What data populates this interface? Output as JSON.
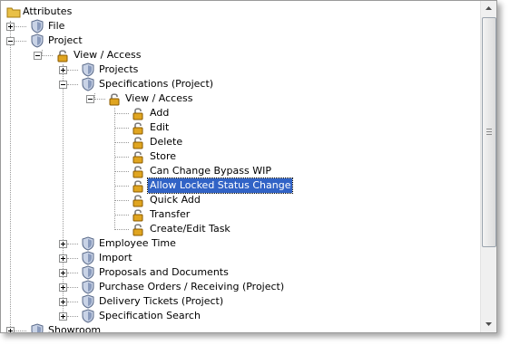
{
  "tree": {
    "nodes": [
      {
        "label": "Attributes",
        "icon": "folder-icon",
        "expander": "none"
      },
      {
        "label": "File",
        "icon": "shield-icon",
        "expander": "plus"
      },
      {
        "label": "Project",
        "icon": "shield-icon",
        "expander": "minus"
      },
      {
        "label": "View / Access",
        "icon": "padlock-icon",
        "expander": "minus"
      },
      {
        "label": "Projects",
        "icon": "shield-icon",
        "expander": "plus"
      },
      {
        "label": "Specifications (Project)",
        "icon": "shield-icon",
        "expander": "minus"
      },
      {
        "label": "View / Access",
        "icon": "padlock-icon",
        "expander": "minus"
      },
      {
        "label": "Add",
        "icon": "padlock-icon",
        "expander": "none"
      },
      {
        "label": "Edit",
        "icon": "padlock-icon",
        "expander": "none"
      },
      {
        "label": "Delete",
        "icon": "padlock-icon",
        "expander": "none"
      },
      {
        "label": "Store",
        "icon": "padlock-icon",
        "expander": "none"
      },
      {
        "label": "Can Change Bypass WIP",
        "icon": "padlock-icon",
        "expander": "none"
      },
      {
        "label": "Allow Locked Status Change",
        "icon": "padlock-icon",
        "expander": "none",
        "selected": true
      },
      {
        "label": "Quick Add",
        "icon": "padlock-icon",
        "expander": "none"
      },
      {
        "label": "Transfer",
        "icon": "padlock-icon",
        "expander": "none"
      },
      {
        "label": "Create/Edit Task",
        "icon": "padlock-icon",
        "expander": "none"
      },
      {
        "label": "Employee Time",
        "icon": "shield-icon",
        "expander": "plus"
      },
      {
        "label": "Import",
        "icon": "shield-icon",
        "expander": "plus"
      },
      {
        "label": "Proposals and Documents",
        "icon": "shield-icon",
        "expander": "plus"
      },
      {
        "label": "Purchase Orders / Receiving (Project)",
        "icon": "shield-icon",
        "expander": "plus"
      },
      {
        "label": "Delivery Tickets (Project)",
        "icon": "shield-icon",
        "expander": "plus"
      },
      {
        "label": "Specification Search",
        "icon": "shield-icon",
        "expander": "plus"
      },
      {
        "label": "Showroom",
        "icon": "shield-icon",
        "expander": "plus"
      }
    ]
  },
  "scrollbar": {
    "up_icon": "scroll-up-arrow-icon",
    "down_icon": "scroll-down-arrow-icon",
    "position_fraction": 0.0,
    "visible_fraction": 0.76
  },
  "colors": {
    "selection": "#3163c6",
    "lock_body": "#e0a520",
    "shield_light": "#c9d3e6",
    "shield_dark": "#5b6b8a",
    "folder": "#e9c046"
  }
}
